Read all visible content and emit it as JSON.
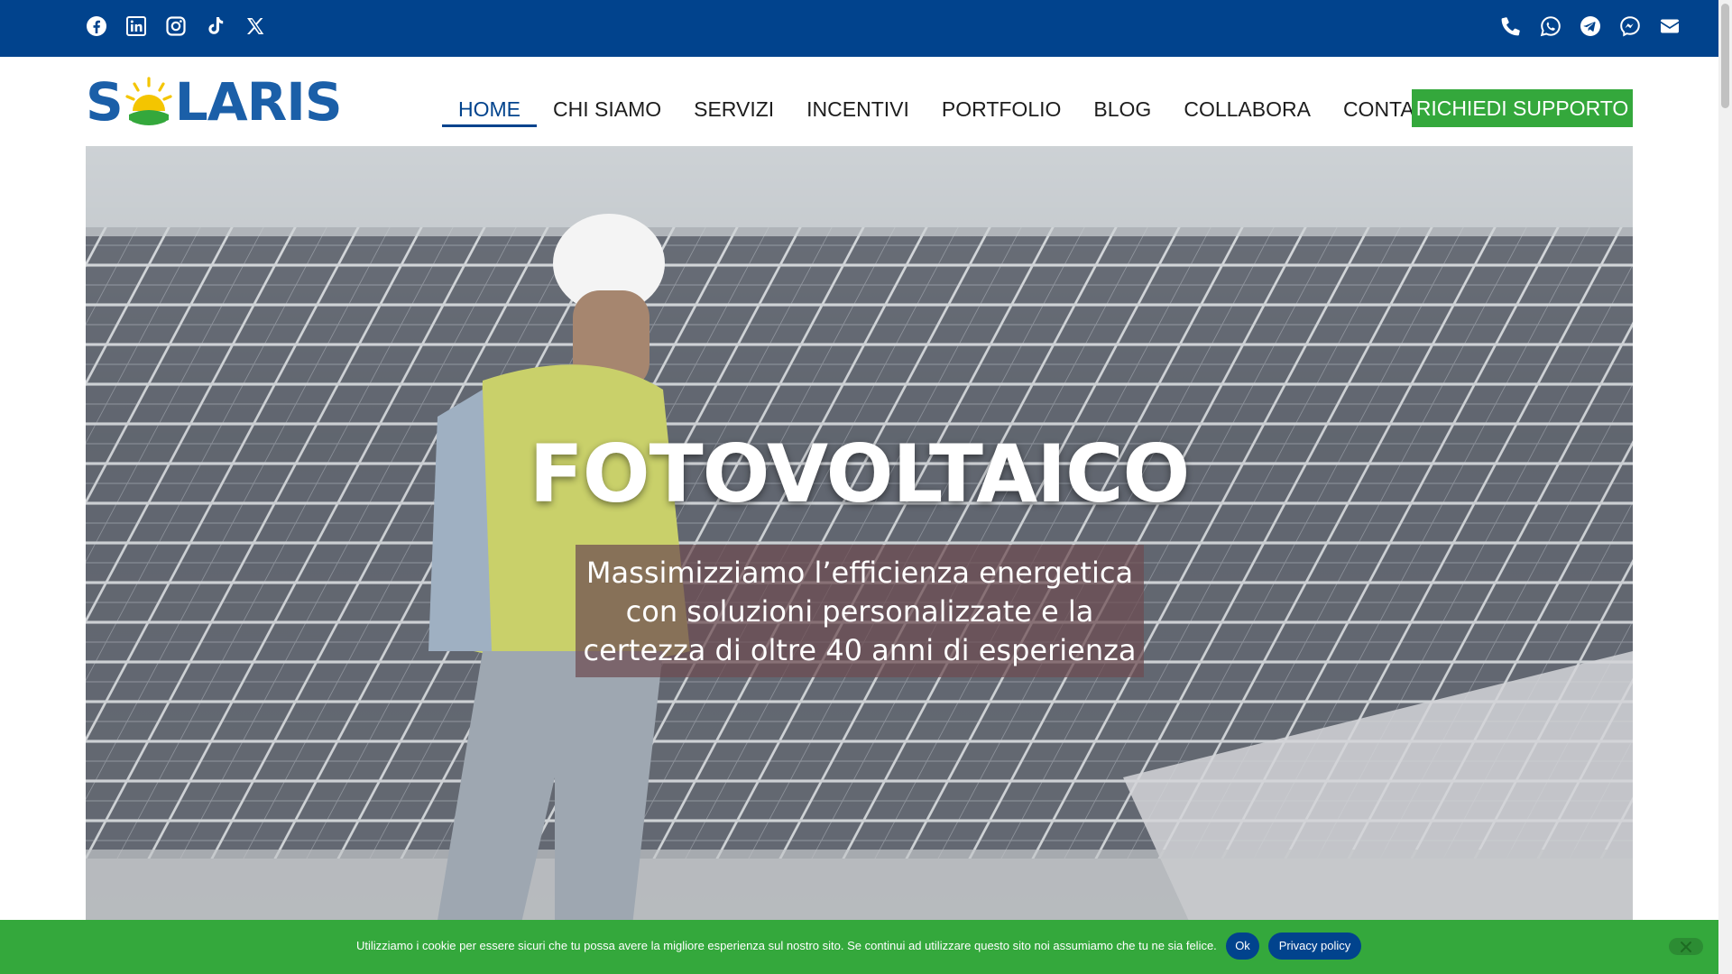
{
  "brand": {
    "name": "SOLARIS",
    "name_left": "S",
    "name_right": "LARIS",
    "primary_color": "#01438d",
    "accent_color": "#34a83c",
    "sun_color": "#f4c500"
  },
  "topbar": {
    "social": [
      "facebook-icon",
      "linkedin-icon",
      "instagram-icon",
      "tiktok-icon",
      "x-icon"
    ],
    "contact": [
      "phone-icon",
      "whatsapp-icon",
      "telegram-icon",
      "messenger-icon",
      "email-icon"
    ]
  },
  "nav": {
    "items": [
      {
        "label": "HOME",
        "active": true
      },
      {
        "label": "CHI SIAMO"
      },
      {
        "label": "SERVIZI"
      },
      {
        "label": "INCENTIVI"
      },
      {
        "label": "PORTFOLIO"
      },
      {
        "label": "BLOG"
      },
      {
        "label": "COLLABORA"
      },
      {
        "label": "CONTATTI"
      }
    ],
    "cta_label": "RICHIEDI SUPPORTO"
  },
  "hero": {
    "title": "FOTOVOLTAICO",
    "subtitle_lines": [
      "Massimizziamo l’efficienza energetica",
      "con soluzioni personalizzate e la",
      "certezza di oltre 40 anni di esperienza"
    ]
  },
  "cookie": {
    "text": "Utilizziamo i cookie per essere sicuri che tu possa avere la migliore esperienza sul nostro sito. Se continui ad utilizzare questo sito noi assumiamo che tu ne sia felice.",
    "ok_label": "Ok",
    "privacy_label": "Privacy policy"
  }
}
